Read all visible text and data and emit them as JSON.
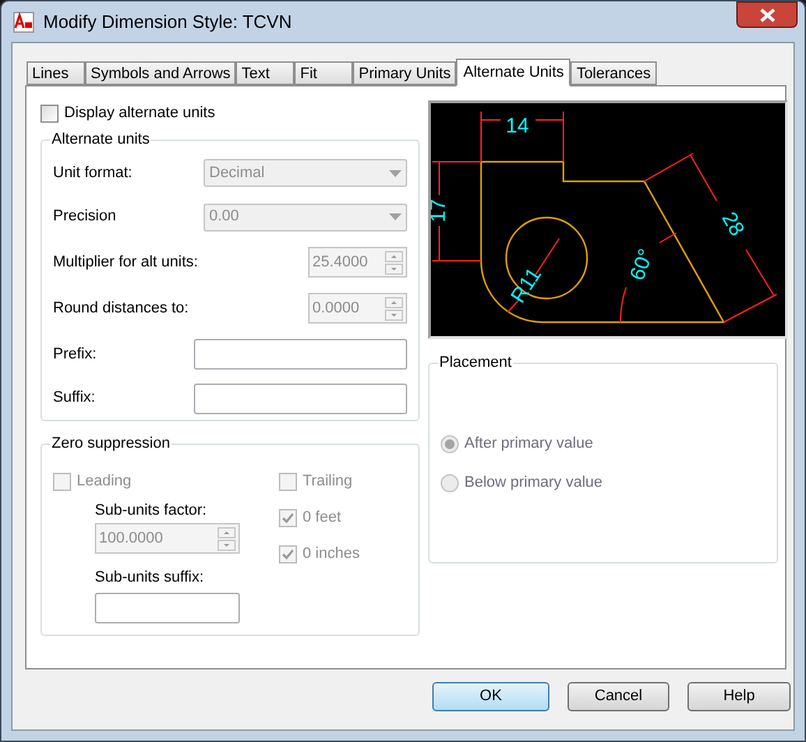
{
  "window": {
    "title": "Modify Dimension Style: TCVN"
  },
  "tabs": [
    {
      "label": "Lines",
      "selected": false
    },
    {
      "label": "Symbols and Arrows",
      "selected": false
    },
    {
      "label": "Text",
      "selected": false
    },
    {
      "label": "Fit",
      "selected": false
    },
    {
      "label": "Primary Units",
      "selected": false
    },
    {
      "label": "Alternate Units",
      "selected": true
    },
    {
      "label": "Tolerances",
      "selected": false
    }
  ],
  "display_alternate_units": {
    "label": "Display alternate units",
    "checked": false
  },
  "alternate_units": {
    "title": "Alternate units",
    "fields": [
      {
        "kind": "select",
        "label": "Unit format:",
        "value": "Decimal",
        "disabled": true
      },
      {
        "kind": "select",
        "label": "Precision",
        "value": "0.00",
        "disabled": true
      },
      {
        "kind": "spinner",
        "label": "Multiplier for alt units:",
        "value": "25.4000",
        "disabled": true
      },
      {
        "kind": "spinner",
        "label": "Round distances  to:",
        "value": "0.0000",
        "disabled": true
      },
      {
        "kind": "text",
        "label": "Prefix:"
      },
      {
        "kind": "text",
        "label": "Suffix:"
      }
    ]
  },
  "zero_suppression": {
    "title": "Zero suppression",
    "leading": {
      "label": "Leading",
      "checked": false,
      "disabled": true
    },
    "sub_units_factor": {
      "label": "Sub-units factor:",
      "value": "100.0000",
      "disabled": true
    },
    "sub_units_suffix": {
      "label": "Sub-units suffix:"
    },
    "trailing": {
      "label": "Trailing",
      "checked": false,
      "disabled": true
    },
    "feet": {
      "label": "0 feet",
      "checked": true,
      "disabled": true
    },
    "inches": {
      "label": "0 inches",
      "checked": true,
      "disabled": true
    }
  },
  "preview": {
    "dimension_labels": [
      "14",
      "17",
      "28",
      "60°",
      "R11"
    ]
  },
  "placement": {
    "title": "Placement",
    "options": [
      {
        "label": "After primary value",
        "selected": true,
        "disabled": true
      },
      {
        "label": "Below primary value",
        "selected": false,
        "disabled": true
      }
    ]
  },
  "buttons": [
    {
      "label": "OK",
      "default": true
    },
    {
      "label": "Cancel",
      "default": false
    },
    {
      "label": "Help",
      "default": false
    }
  ]
}
